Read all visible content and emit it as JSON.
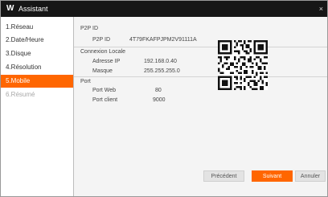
{
  "window": {
    "logo": "W",
    "title": "Assistant",
    "close": "×"
  },
  "sidebar": {
    "items": [
      {
        "label": "1.Réseau"
      },
      {
        "label": "2.Date/Heure"
      },
      {
        "label": "3.Disque"
      },
      {
        "label": "4.Résolution"
      },
      {
        "label": "5.Mobile",
        "state": "active"
      },
      {
        "label": "6.Résumé",
        "state": "disabled"
      }
    ]
  },
  "main": {
    "p2p": {
      "section": "P2P ID",
      "label": "P2P ID",
      "value": "4T79FKAFPJPM2V91111A"
    },
    "connexion": {
      "section": "Connexion Locale",
      "ip_label": "Adresse IP",
      "ip_value": "192.168.0.40",
      "mask_label": "Masque",
      "mask_value": "255.255.255.0"
    },
    "port": {
      "section": "Port",
      "web_label": "Port Web",
      "web_value": "80",
      "client_label": "Port client",
      "client_value": "9000"
    }
  },
  "buttons": {
    "prev": "Précédent",
    "next": "Suivant",
    "cancel": "Annuler"
  },
  "colors": {
    "accent": "#ff6600",
    "titlebar": "#161616"
  }
}
